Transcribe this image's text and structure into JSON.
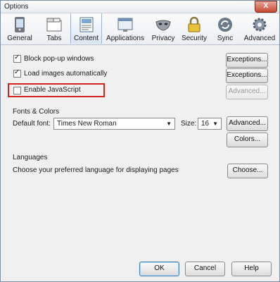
{
  "window": {
    "title": "Options",
    "close_label": "X"
  },
  "toolbar": {
    "tabs": [
      {
        "label": "General",
        "icon": "phone-icon"
      },
      {
        "label": "Tabs",
        "icon": "tabs-icon"
      },
      {
        "label": "Content",
        "icon": "content-icon",
        "selected": true
      },
      {
        "label": "Applications",
        "icon": "applications-icon"
      },
      {
        "label": "Privacy",
        "icon": "mask-icon"
      },
      {
        "label": "Security",
        "icon": "lock-icon"
      },
      {
        "label": "Sync",
        "icon": "sync-icon"
      },
      {
        "label": "Advanced",
        "icon": "gear-icon"
      }
    ]
  },
  "content": {
    "block_popups": {
      "label": "Block pop-up windows",
      "checked": true,
      "button": "Exceptions..."
    },
    "load_images": {
      "label": "Load images automatically",
      "checked": true,
      "button": "Exceptions..."
    },
    "enable_js": {
      "label": "Enable JavaScript",
      "checked": false,
      "button": "Advanced..."
    },
    "fonts": {
      "section_label": "Fonts & Colors",
      "default_font_label": "Default font:",
      "default_font_value": "Times New Roman",
      "size_label": "Size:",
      "size_value": "16",
      "advanced_button": "Advanced...",
      "colors_button": "Colors..."
    },
    "languages": {
      "section_label": "Languages",
      "description": "Choose your preferred language for displaying pages",
      "choose_button": "Choose..."
    }
  },
  "footer": {
    "ok": "OK",
    "cancel": "Cancel",
    "help": "Help"
  }
}
